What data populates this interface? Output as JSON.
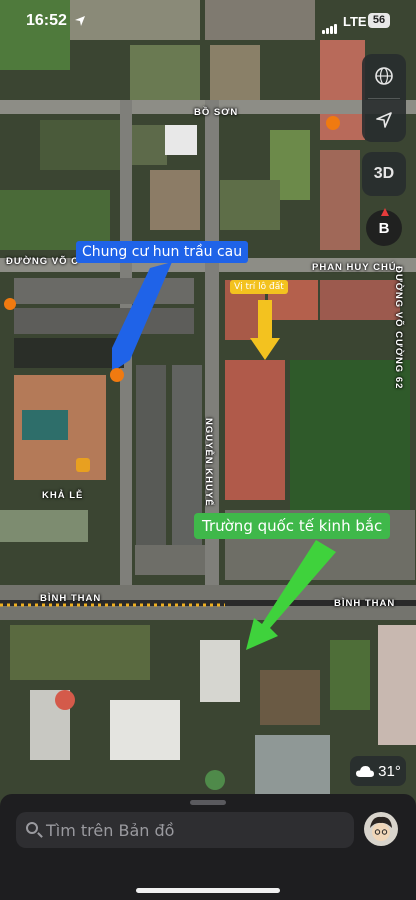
{
  "status_bar": {
    "time": "16:52",
    "network": "LTE",
    "battery": "56"
  },
  "controls": {
    "three_d_label": "3D",
    "compass_label": "B"
  },
  "road_labels": {
    "bo_son": "BỒ SƠN",
    "duong_vo_c": "ĐƯỜNG VÕ C",
    "phan_huy_chu": "PHAN HUY CHÚ",
    "duong_vo_cuong": "ĐƯỜNG VÕ CƯỜNG 62",
    "kha_le": "KHẢ LỄ",
    "nguyen_khuyen": "NGUYỄN KHUYẾ",
    "binh_than_left": "BÌNH THAN",
    "binh_than_right": "BÌNH THAN"
  },
  "callouts": {
    "chung_cu": "Chung cư hun trầu cau",
    "vi_tri": "Vị trí lô đất",
    "truong": "Trường quốc tế kinh bắc"
  },
  "colors": {
    "blue_callout": "#1f63e8",
    "yellow_callout": "#f3c21f",
    "green_callout": "#3fb84a"
  },
  "weather": {
    "temperature": "31°"
  },
  "search": {
    "placeholder": "Tìm trên Bản đồ"
  }
}
